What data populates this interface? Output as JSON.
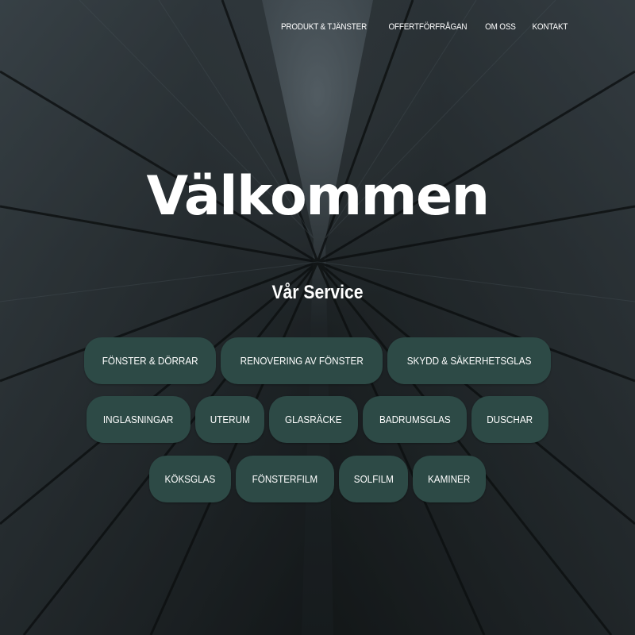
{
  "nav": {
    "items": [
      {
        "label": "PRODUKT & TJÄNSTER"
      },
      {
        "label": "OFFERTFÖRFRÅGAN"
      },
      {
        "label": "OM OSS"
      },
      {
        "label": "KONTAKT"
      }
    ]
  },
  "hero": {
    "title": "Välkommen",
    "subtitle": "Vår Service"
  },
  "services": {
    "row1": [
      "FÖNSTER & DÖRRAR",
      "RENOVERING AV FÖNSTER",
      "SKYDD & SÄKERHETSGLAS"
    ],
    "row2": [
      "INGLASNINGAR",
      "UTERUM",
      "GLASRÄCKE",
      "BADRUMSGLAS",
      "DUSCHAR"
    ],
    "row3": [
      "KÖKSGLAS",
      "FÖNSTERFILM",
      "SOLFILM",
      "KAMINER"
    ]
  },
  "colors": {
    "pill_background": "#2d4a46",
    "text": "#ffffff",
    "background": "#1e2326"
  }
}
